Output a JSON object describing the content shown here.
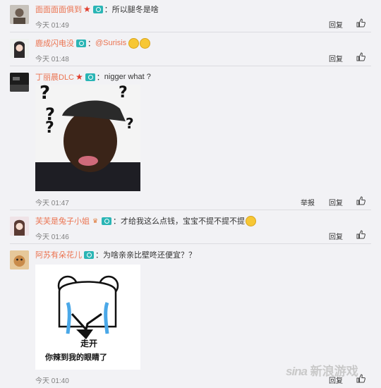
{
  "comments": [
    {
      "username": "面面面面俱到",
      "text": "所以腿冬是啥",
      "time": "今天 01:49",
      "reply": "回复"
    },
    {
      "username": "鹿成闪电没",
      "text": "@Surisis",
      "time": "今天 01:48",
      "reply": "回复"
    },
    {
      "username": "丁丽晨DLC",
      "text": "nigger what ?",
      "time": "今天 01:47",
      "report": "举报",
      "reply": "回复"
    },
    {
      "username": "芙芙是兔子小姐",
      "text": "才给我这么点钱，宝宝不提不提不提",
      "time": "今天 01:46",
      "reply": "回复"
    },
    {
      "username": "阿苏有朵花儿",
      "text": "为啥亲亲比壁咚还便宜？？",
      "time": "今天 01:40",
      "reply": "回复"
    }
  ],
  "meme": {
    "line1": "走开",
    "line2": "你辣到我的眼睛了"
  },
  "watermark": {
    "logo": "sina",
    "text": "新浪游戏"
  }
}
